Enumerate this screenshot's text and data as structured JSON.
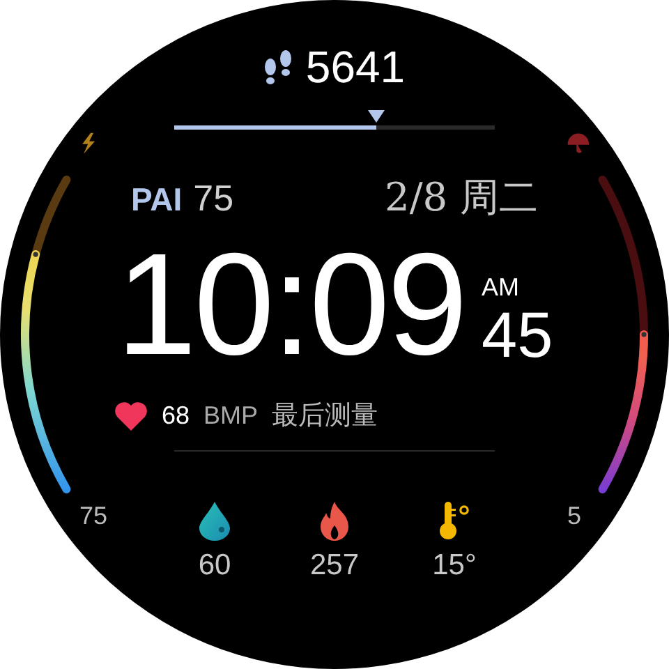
{
  "steps": {
    "value": "5641",
    "level": 0.63
  },
  "pai": {
    "label": "PAI",
    "value": "75"
  },
  "date": "2/8 周二",
  "time": {
    "hours_minutes": "10:09",
    "period": "AM",
    "seconds": "45"
  },
  "heart_rate": {
    "value": "68",
    "unit": "BMP",
    "note": "最后测量"
  },
  "gauges": [
    {
      "kind": "charge",
      "reading": "75"
    },
    {
      "kind": "umbrella",
      "reading": "5"
    }
  ],
  "stats": [
    {
      "kind": "drop",
      "value": "60"
    },
    {
      "kind": "flame",
      "value": "257"
    },
    {
      "kind": "thermometer",
      "value": "15°"
    }
  ]
}
